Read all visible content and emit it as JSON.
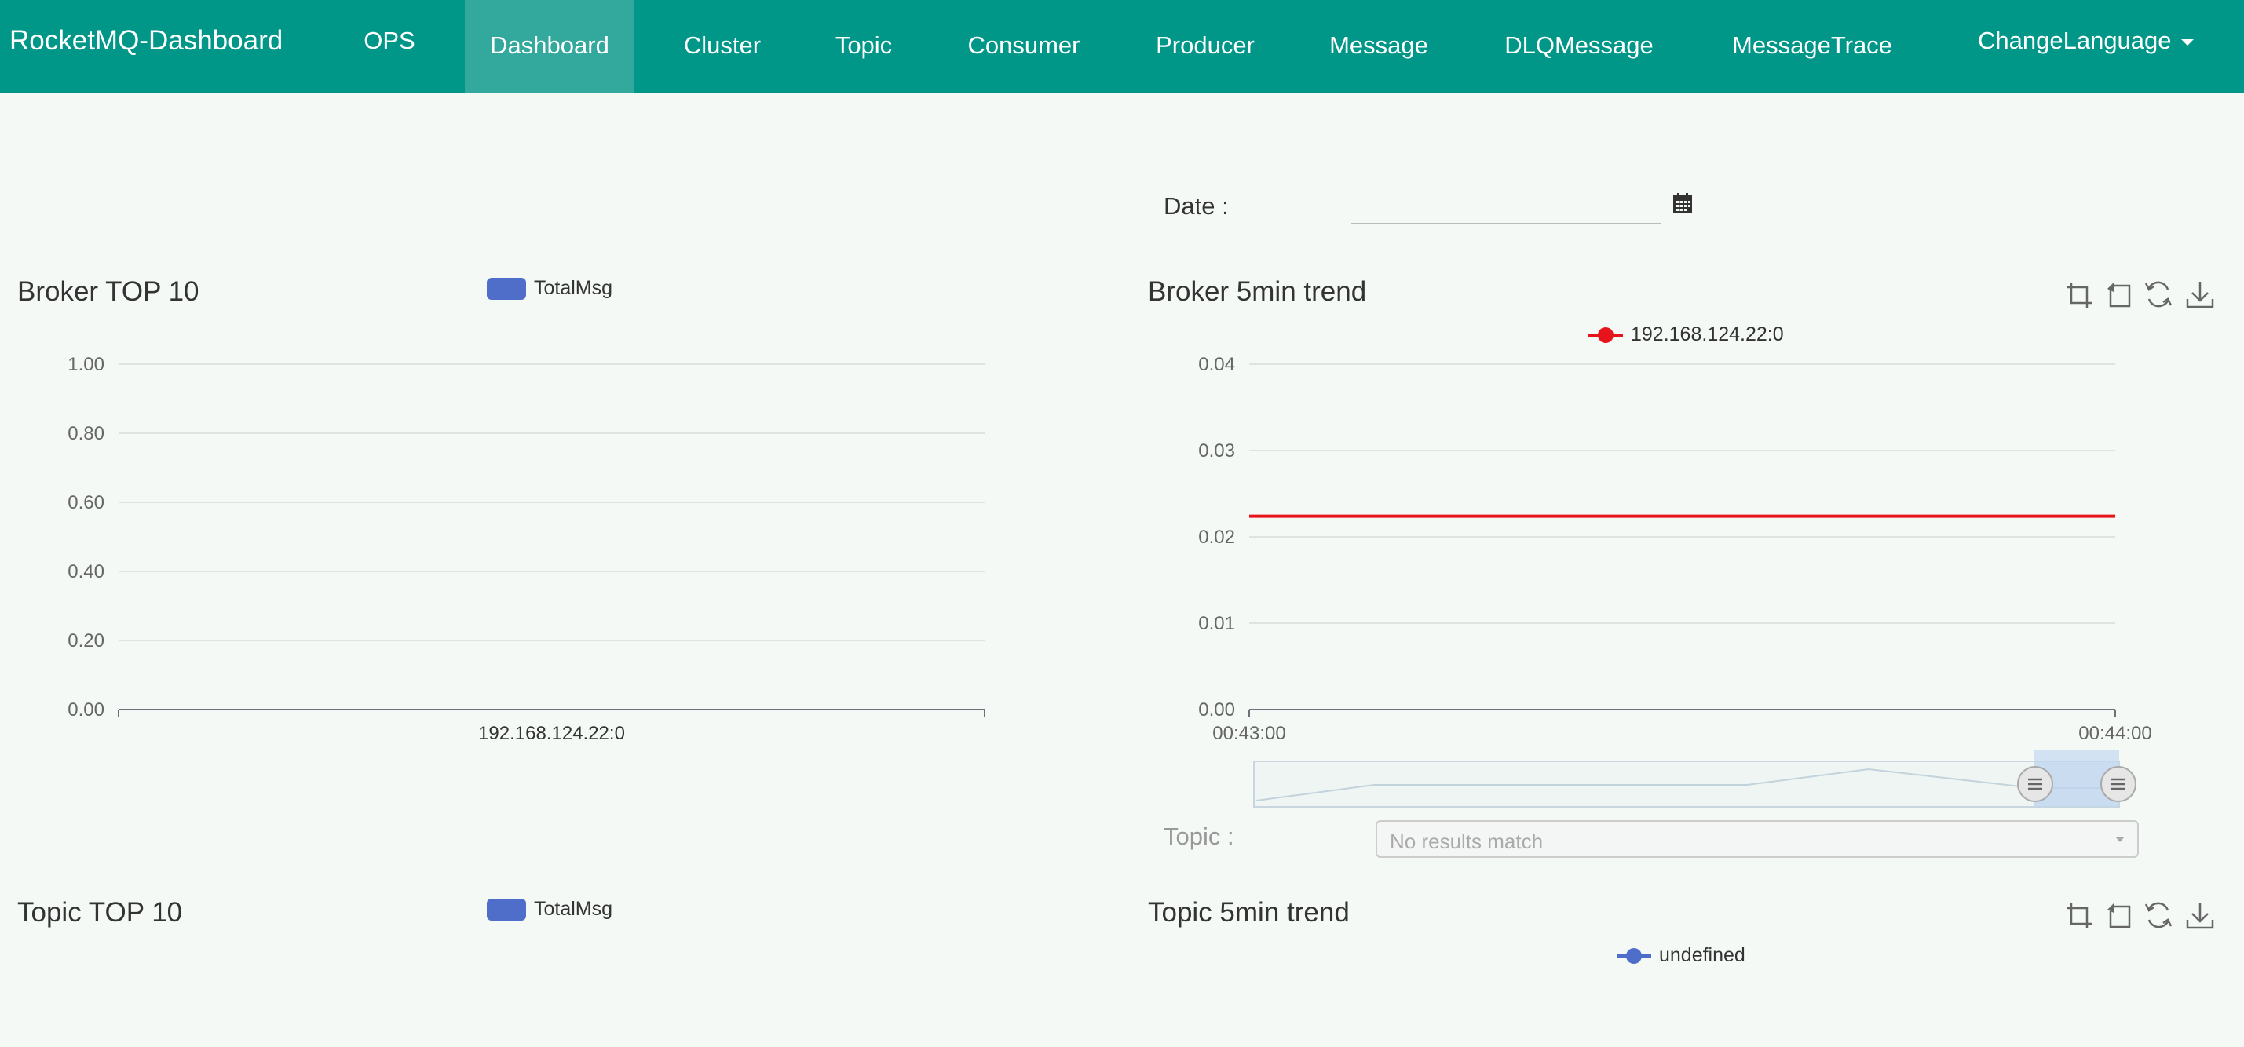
{
  "nav": {
    "brand": "RocketMQ-Dashboard",
    "items": [
      {
        "label": "OPS"
      },
      {
        "label": "Dashboard",
        "active": true
      },
      {
        "label": "Cluster"
      },
      {
        "label": "Topic"
      },
      {
        "label": "Consumer"
      },
      {
        "label": "Producer"
      },
      {
        "label": "Message"
      },
      {
        "label": "DLQMessage"
      },
      {
        "label": "MessageTrace"
      }
    ],
    "change_language": "ChangeLanguage",
    "background_color": "#009688",
    "active_color": "#33a89d"
  },
  "date": {
    "label": "Date :",
    "value": "",
    "icon": "calendar-icon"
  },
  "broker_top10": {
    "title": "Broker TOP 10",
    "legend": "TotalMsg",
    "color": "#4f6ec9"
  },
  "broker_trend": {
    "title": "Broker 5min trend",
    "legend": "192.168.124.22:0",
    "color": "#e8141b",
    "toolbox": [
      "zoom-icon",
      "zoom-reset-icon",
      "restore-icon",
      "download-icon"
    ]
  },
  "topic": {
    "label": "Topic :",
    "placeholder": "No results match"
  },
  "topic_top10": {
    "title": "Topic TOP 10",
    "legend": "TotalMsg",
    "color": "#4f6ec9"
  },
  "topic_trend": {
    "title": "Topic 5min trend",
    "legend": "undefined",
    "color": "#4f6ec9",
    "toolbox": [
      "zoom-icon",
      "zoom-reset-icon",
      "restore-icon",
      "download-icon"
    ]
  },
  "chart_data": [
    {
      "type": "bar",
      "title": "Broker TOP 10",
      "categories": [
        "192.168.124.22:0"
      ],
      "series": [
        {
          "name": "TotalMsg",
          "values": [
            0
          ]
        }
      ],
      "yticks": [
        "0.00",
        "0.20",
        "0.40",
        "0.60",
        "0.80",
        "1.00"
      ],
      "ylim": [
        0,
        1
      ],
      "grid": true,
      "legend_position": "top"
    },
    {
      "type": "line",
      "title": "Broker 5min trend",
      "x": [
        "00:43:00",
        "00:44:00"
      ],
      "xticks": [
        "00:43:00",
        "00:44:00"
      ],
      "series": [
        {
          "name": "192.168.124.22:0",
          "values": [
            0.0224,
            0.0224
          ],
          "color": "#e8141b"
        }
      ],
      "yticks": [
        "0.00",
        "0.01",
        "0.02",
        "0.03",
        "0.04"
      ],
      "ylim": [
        0,
        0.04
      ],
      "grid": true,
      "legend_position": "top",
      "datazoom_range": [
        0.9,
        1.0
      ]
    }
  ]
}
